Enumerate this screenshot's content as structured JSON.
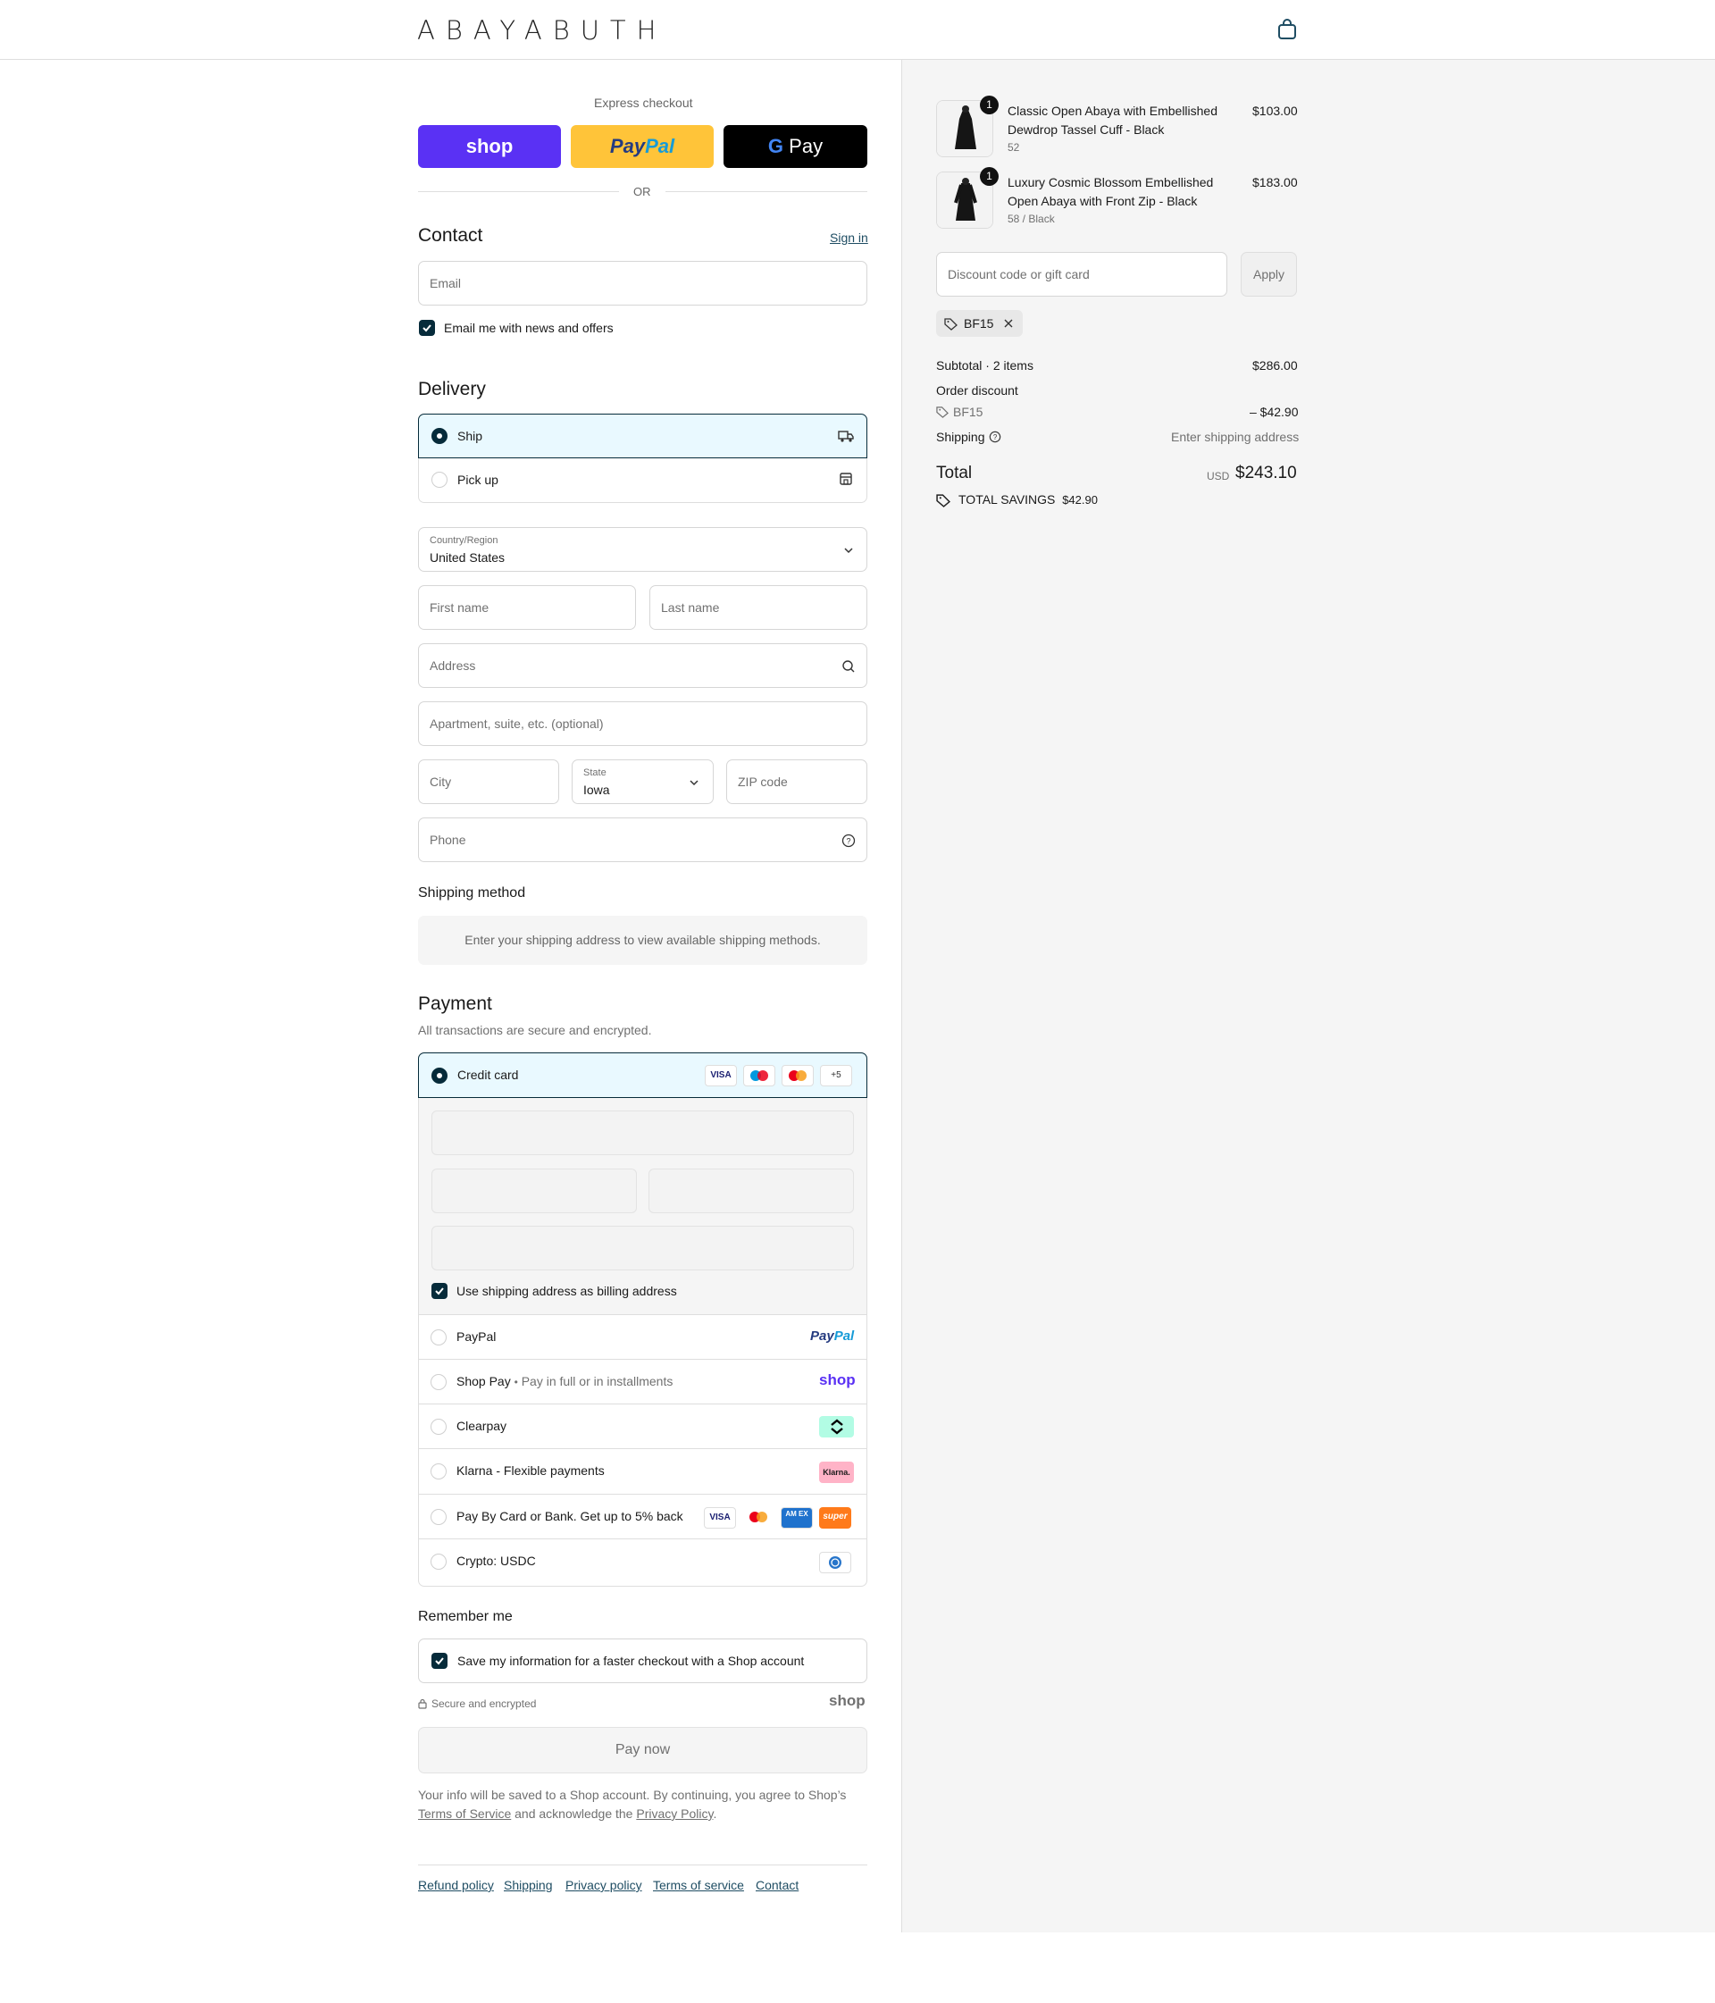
{
  "brand": {
    "logo_text": "ABAYABUTH"
  },
  "express": {
    "title": "Express checkout",
    "shop_label": "shop",
    "paypal_label_a": "Pay",
    "paypal_label_b": "Pal",
    "gpay_label": "Pay",
    "or_label": "OR"
  },
  "contact": {
    "title": "Contact",
    "signin_label": "Sign in",
    "email_placeholder": "Email",
    "newsletter_label": "Email me with news and offers",
    "newsletter_checked": true
  },
  "delivery": {
    "title": "Delivery",
    "options": [
      {
        "label": "Ship",
        "selected": true,
        "icon": "truck-icon"
      },
      {
        "label": "Pick up",
        "selected": false,
        "icon": "store-icon"
      }
    ],
    "country_label": "Country/Region",
    "country_value": "United States",
    "first_name_placeholder": "First name",
    "last_name_placeholder": "Last name",
    "address_placeholder": "Address",
    "apartment_placeholder": "Apartment, suite, etc. (optional)",
    "city_placeholder": "City",
    "state_label": "State",
    "state_value": "Iowa",
    "zip_placeholder": "ZIP code",
    "phone_placeholder": "Phone"
  },
  "shipping_method": {
    "title": "Shipping method",
    "notice": "Enter your shipping address to view available shipping methods."
  },
  "payment": {
    "title": "Payment",
    "subtitle": "All transactions are secure and encrypted.",
    "credit_card_label": "Credit card",
    "more_cards": "+5",
    "billing_same_label": "Use shipping address as billing address",
    "billing_same_checked": true,
    "methods": [
      {
        "label": "PayPal"
      },
      {
        "label": "Shop Pay",
        "sub": "Pay in full or in installments",
        "logo": "shop"
      },
      {
        "label": "Clearpay"
      },
      {
        "label": "Klarna - Flexible payments",
        "logo": "Klarna."
      },
      {
        "label": "Pay By Card or Bank. Get up to 5% back",
        "logo": "super"
      },
      {
        "label": "Crypto: USDC"
      }
    ],
    "visa_label": "VISA",
    "amex_label": "AM EX",
    "paypal_logo_a": "Pay",
    "paypal_logo_b": "Pal"
  },
  "remember": {
    "title": "Remember me",
    "save_label": "Save my information for a faster checkout with a Shop account",
    "save_checked": true,
    "secure_label": "Secure and encrypted",
    "shop_logo": "shop"
  },
  "pay_now_label": "Pay now",
  "legal": {
    "line1": "Your info will be saved to a Shop account. By continuing, you agree to Shop’s",
    "tos_link": "Terms of Service",
    "mid": " and acknowledge the ",
    "privacy_link": "Privacy Policy",
    "end": "."
  },
  "footer_links": [
    "Refund policy",
    "Shipping",
    "Privacy policy",
    "Terms of service",
    "Contact"
  ],
  "cart": {
    "items": [
      {
        "qty": "1",
        "name_line1": "Classic Open Abaya with Embellished",
        "name_line2": "Dewdrop Tassel Cuff - Black",
        "variant": "52",
        "price": "$103.00"
      },
      {
        "qty": "1",
        "name_line1": "Luxury Cosmic Blossom Embellished",
        "name_line2": "Open Abaya with Front Zip - Black",
        "variant": "58 / Black",
        "price": "$183.00"
      }
    ],
    "discount_placeholder": "Discount code or gift card",
    "apply_label": "Apply",
    "applied_code": "BF15",
    "subtotal_label": "Subtotal · 2 items",
    "subtotal_value": "$286.00",
    "order_discount_label": "Order discount",
    "discount_code": "BF15",
    "discount_value": "– $42.90",
    "shipping_label": "Shipping",
    "shipping_value": "Enter shipping address",
    "total_label": "Total",
    "currency": "USD",
    "total_value": "$243.10",
    "savings_label": "TOTAL SAVINGS",
    "savings_value": "$42.90"
  },
  "colors": {
    "accent": "#062b3a",
    "selected_bg": "#e9f9ff",
    "shop_purple": "#5a31f4",
    "paypal_yellow": "#ffc439",
    "link": "#1f4d63"
  }
}
